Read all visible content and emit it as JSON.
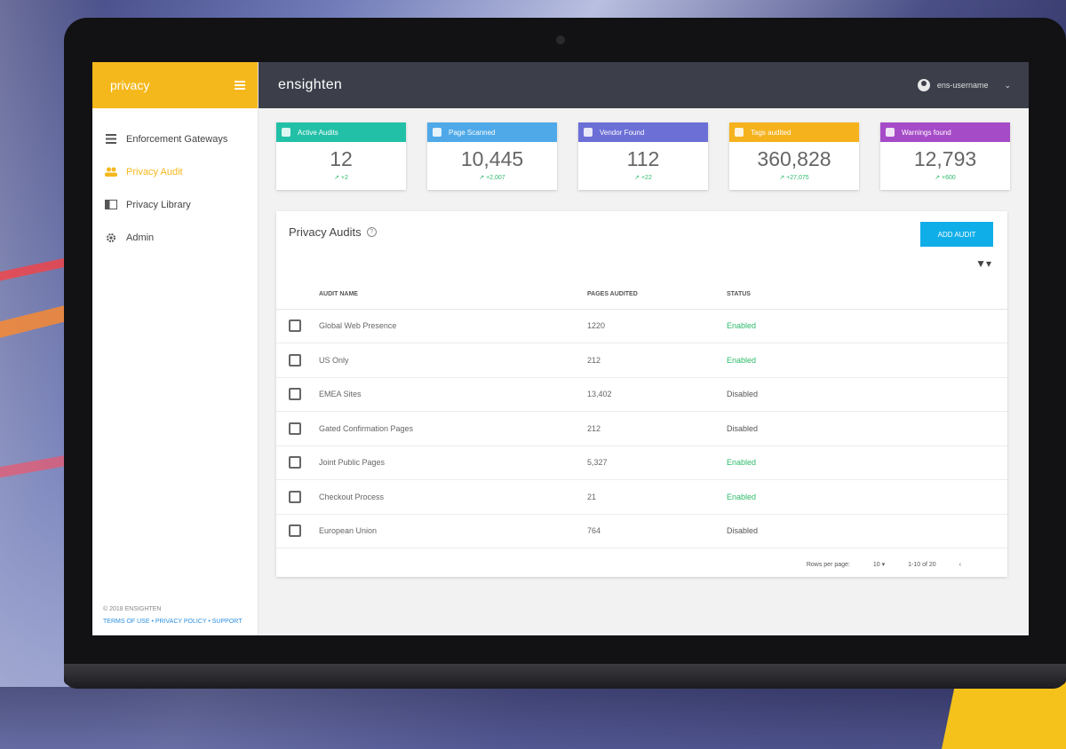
{
  "sidebar": {
    "brand": "privacy",
    "items": [
      {
        "label": "Enforcement Gateways",
        "icon": "list-icon"
      },
      {
        "label": "Privacy Audit",
        "icon": "users-icon",
        "active": true
      },
      {
        "label": "Privacy Library",
        "icon": "library-icon"
      },
      {
        "label": "Admin",
        "icon": "gear-icon"
      }
    ],
    "footer_copyright": "© 2018 ENSIGHTEN",
    "footer_links": "TERMS OF USE • PRIVACY POLICY • SUPPORT"
  },
  "topbar": {
    "logo": "ensighten",
    "username": "ens-username"
  },
  "stats": [
    {
      "label": "Active Audits",
      "value": "12",
      "delta": "+2",
      "color": "#22c0a7"
    },
    {
      "label": "Page Scanned",
      "value": "10,445",
      "delta": "+2,007",
      "color": "#4fa9e8"
    },
    {
      "label": "Vendor Found",
      "value": "112",
      "delta": "+22",
      "color": "#6b6fd6"
    },
    {
      "label": "Tags audited",
      "value": "360,828",
      "delta": "+27,075",
      "color": "#f5b21c"
    },
    {
      "label": "Warnings found",
      "value": "12,793",
      "delta": "+600",
      "color": "#a64bc8"
    }
  ],
  "audits": {
    "title": "Privacy Audits",
    "add_button": "ADD AUDIT",
    "columns": {
      "name": "AUDIT NAME",
      "pages": "PAGES AUDITED",
      "status": "STATUS"
    },
    "rows": [
      {
        "name": "Global Web Presence",
        "pages": "1220",
        "status": "Enabled"
      },
      {
        "name": "US Only",
        "pages": "212",
        "status": "Enabled"
      },
      {
        "name": "EMEA Sites",
        "pages": "13,402",
        "status": "Disabled"
      },
      {
        "name": "Gated Confirmation Pages",
        "pages": "212",
        "status": "Disabled"
      },
      {
        "name": "Joint Public Pages",
        "pages": "5,327",
        "status": "Enabled"
      },
      {
        "name": "Checkout Process",
        "pages": "21",
        "status": "Enabled"
      },
      {
        "name": "European Union",
        "pages": "764",
        "status": "Disabled"
      }
    ],
    "pagination": {
      "rows_per_page_label": "Rows per page:",
      "rows_per_page": "10",
      "range": "1-10 of 20"
    }
  },
  "colors": {
    "accent": "#f5b81c",
    "topbar": "#3c3f4a",
    "button": "#10aee8",
    "enabled": "#2dbb6a"
  }
}
